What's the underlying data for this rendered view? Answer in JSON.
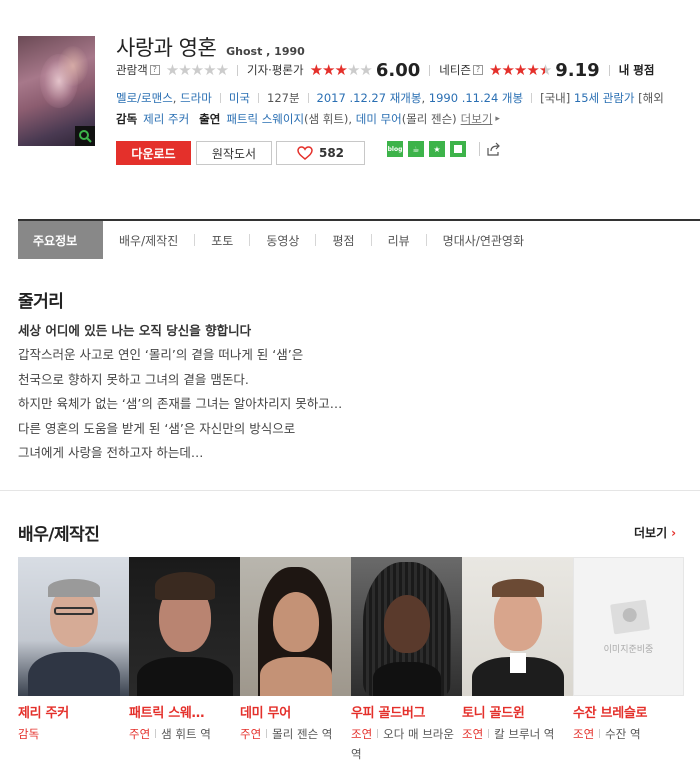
{
  "movie": {
    "title": "사랑과 영혼",
    "subtitle": "Ghost , 1990",
    "audience_label": "관람객",
    "audience_stars": 0,
    "critic_label": "기자·평론가",
    "critic_score": "6.00",
    "critic_stars": 3,
    "netizen_label": "네티즌",
    "netizen_score": "9.19",
    "netizen_stars": 4.5,
    "my_rating_label": "내 평점",
    "help_mark": "?"
  },
  "info": {
    "genre1": "멜로/로맨스",
    "genre2": "드라마",
    "country": "미국",
    "runtime": "127분",
    "release1": "2017 .12.27 재개봉",
    "release2": "1990 .11.24 개봉",
    "rating_prefix": "[국내]",
    "rating": "15세 관람가",
    "overseas_prefix": "[해외"
  },
  "crew": {
    "director_label": "감독",
    "director": "제리 주커",
    "cast_label": "출연",
    "cast1": "패트릭 스웨이지",
    "cast1_role": "(샘 휘트)",
    "cast2": "데미 무어",
    "cast2_role": "(몰리 젠슨)",
    "more": "더보기"
  },
  "buttons": {
    "download": "다운로드",
    "original_book": "원작도서",
    "like_count": "582"
  },
  "share_icons": [
    "blog-share-icon",
    "cafe-share-icon",
    "star-share-icon",
    "square-share-icon"
  ],
  "tabs": [
    "주요정보",
    "배우/제작진",
    "포토",
    "동영상",
    "평점",
    "리뷰",
    "명대사/연관영화"
  ],
  "synopsis": {
    "title": "줄거리",
    "headline": "세상 어디에 있든 나는 오직 당신을 향합니다",
    "lines": [
      "갑작스러운 사고로 연인 ‘몰리’의 곁을 떠나게 된 ‘샘’은",
      " 천국으로 향하지 못하고 그녀의 곁을 맴돈다.",
      " 하지만 육체가 없는 ‘샘’의 존재를 그녀는 알아차리지 못하고…",
      " 다른 영혼의 도움을 받게 된 ‘샘’은 자신만의 방식으로",
      " 그녀에게 사랑을 전하고자 하는데…"
    ]
  },
  "cast_section": {
    "title": "배우/제작진",
    "more": "더보기",
    "placeholder_text": "이미지준비중",
    "people": [
      {
        "name": "제리 주커",
        "role_type": "감독",
        "role": ""
      },
      {
        "name": "패트릭 스웨…",
        "role_type": "주연",
        "role": "샘 휘트 역"
      },
      {
        "name": "데미 무어",
        "role_type": "주연",
        "role": "몰리 젠슨 역"
      },
      {
        "name": "우피 골드버그",
        "role_type": "조연",
        "role": "오다 매 브라운 역"
      },
      {
        "name": "토니 골드윈",
        "role_type": "조연",
        "role": "칼 브루너 역"
      },
      {
        "name": "수잔 브레슬로",
        "role_type": "조연",
        "role": "수잔 역"
      }
    ]
  },
  "colors": {
    "accent": "#e4302b",
    "link": "#2a6fb3",
    "tab_active": "#888888"
  }
}
